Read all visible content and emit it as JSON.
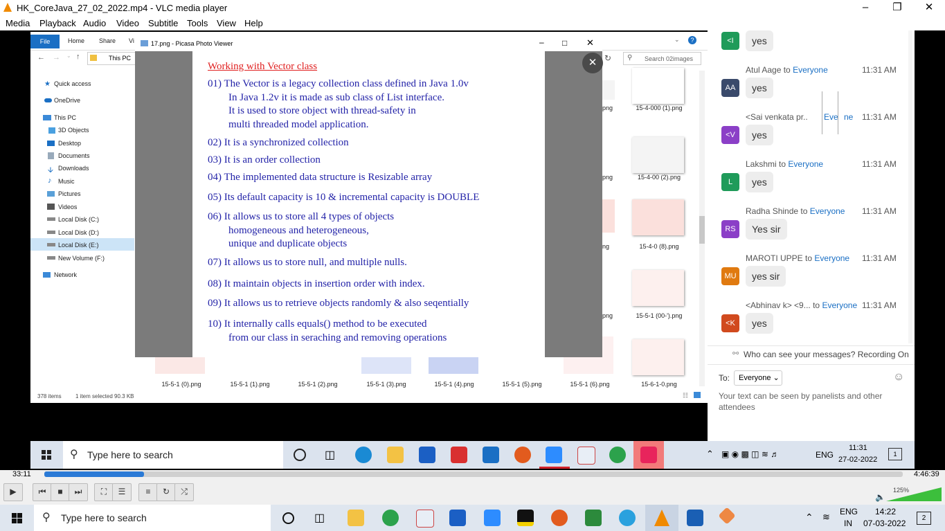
{
  "vlc": {
    "title": "HK_CoreJava_27_02_2022.mp4 - VLC media player",
    "menu": [
      "Media",
      "Playback",
      "Audio",
      "Video",
      "Subtitle",
      "Tools",
      "View",
      "Help"
    ],
    "time_elapsed": "33:11",
    "time_total": "4:46:39",
    "progress_fraction": 0.116,
    "volume_label": "125%",
    "volume_fraction": 1.0
  },
  "explorer": {
    "tabs": {
      "file": "File",
      "home": "Home",
      "share": "Share",
      "view": "Vi"
    },
    "address": "This PC",
    "search_placeholder": "Search 02images",
    "nav": [
      "Quick access",
      "OneDrive",
      "This PC",
      "3D Objects",
      "Desktop",
      "Documents",
      "Downloads",
      "Music",
      "Pictures",
      "Videos",
      "Local Disk (C:)",
      "Local Disk (D:)",
      "Local Disk (E:)",
      "New Volume (F:)",
      "Network"
    ],
    "right_files": [
      "15-4-000 (1).png",
      "15-4-00 (2).png",
      "15-4-0 (8).png",
      "15-5-1 (00-').png"
    ],
    "partial_labels": [
      "png",
      "png",
      "ng",
      "png"
    ],
    "bottom_files": [
      "15-5-1 (0).png",
      "15-5-1 (1).png",
      "15-5-1 (2).png",
      "15-5-1 (3).png",
      "15-5-1 (4).png",
      "15-5-1 (5).png",
      "15-5-1 (6).png",
      "15-6-1-0.png"
    ],
    "status_items": "378 items",
    "status_selected": "1 item selected  90.3 KB"
  },
  "picasa": {
    "title": "17.png - Picasa Photo Viewer",
    "slide_title": "Working with Vector class",
    "lines": [
      "01)  The Vector is a  legacy collection class defined in Java 1.0v",
      "In Java 1.2v it is made as sub class of List interface.",
      "It is used to store object with thread-safety in",
      "multi threaded model application.",
      "02) It is a synchronized collection",
      "03) It is an order collection",
      "04) The implemented data structure is Resizable array",
      "05) Its default capacity is 10 & incremental capacity is DOUBLE",
      "06) It allows us to store all 4 types of objects",
      "homogeneous and heterogeneous,",
      "unique and duplicate objects",
      "07)  It allows us to store null, and multiple nulls.",
      "08)  It maintain objects in insertion order with index.",
      "09)  It allows us to retrieve objects randomly & also seqentially",
      "10) It internally calls equals() method to be executed",
      "from our class in seraching and removing operations"
    ]
  },
  "chat": {
    "top_message": {
      "avatar": "<I",
      "text": "yes"
    },
    "messages": [
      {
        "sender": "Atul Aage",
        "to": "Everyone",
        "time": "11:31 AM",
        "avatar": "AA",
        "color": "#3a4a6b",
        "text": "yes"
      },
      {
        "sender": "<Sai venkata pr..",
        "to": "Eve",
        "to_tail": "ne",
        "time": "11:31 AM",
        "avatar": "<V",
        "color": "#8b3fc7",
        "text": "yes"
      },
      {
        "sender": "Lakshmi",
        "to": "Everyone",
        "time": "11:31 AM",
        "avatar": "L",
        "color": "#1f9b5a",
        "text": "yes"
      },
      {
        "sender": "Radha Shinde",
        "to": "Everyone",
        "time": "11:31 AM",
        "avatar": "RS",
        "color": "#8b3fc7",
        "text": "Yes sir"
      },
      {
        "sender": "MAROTI UPPE",
        "to": "Everyone",
        "time": "11:31 AM",
        "avatar": "MU",
        "color": "#e07a10",
        "text": "yes sir"
      },
      {
        "sender": "<Abhinav k> <9...",
        "to": "Everyone",
        "time": "11:31 AM",
        "avatar": "<K",
        "color": "#d14a1e",
        "text": "yes"
      }
    ],
    "to_word": "to",
    "notice": "Who can see your messages? Recording On",
    "to_label": "To:",
    "to_value": "Everyone",
    "placeholder": "Your text can be seen by panelists and other attendees"
  },
  "inner_taskbar": {
    "search": "Type here to search",
    "lang": "ENG",
    "time": "11:31",
    "date": "27-02-2022",
    "badge": "1"
  },
  "outer_taskbar": {
    "search": "Type here to search",
    "lang": "ENG",
    "region": "IN",
    "time": "14:22",
    "date": "07-03-2022",
    "badge": "2"
  }
}
